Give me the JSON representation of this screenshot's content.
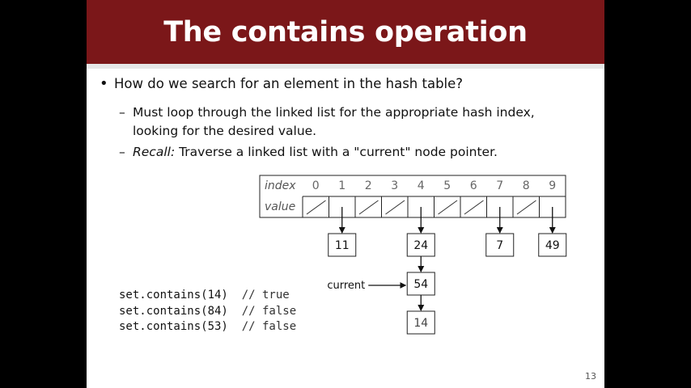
{
  "slide": {
    "title": "The contains operation",
    "bullet": "How do we search for an element in the hash table?",
    "sub1": "Must loop through the linked list for the appropriate hash index, looking for the desired value.",
    "sub2_prefix": "Recall:",
    "sub2_rest": " Traverse a linked list with a \"current\" node pointer.",
    "dash": "–",
    "bullet_glyph": "•",
    "page_number": "13"
  },
  "table": {
    "index_label": "index",
    "value_label": "value",
    "indices": [
      "0",
      "1",
      "2",
      "3",
      "4",
      "5",
      "6",
      "7",
      "8",
      "9"
    ],
    "slots": [
      {
        "index": "0",
        "nodes": []
      },
      {
        "index": "1",
        "nodes": [
          "11"
        ]
      },
      {
        "index": "2",
        "nodes": []
      },
      {
        "index": "3",
        "nodes": []
      },
      {
        "index": "4",
        "nodes": [
          "24",
          "54",
          "14"
        ]
      },
      {
        "index": "5",
        "nodes": []
      },
      {
        "index": "6",
        "nodes": []
      },
      {
        "index": "7",
        "nodes": [
          "7"
        ]
      },
      {
        "index": "8",
        "nodes": []
      },
      {
        "index": "9",
        "nodes": [
          "49"
        ]
      }
    ],
    "current_label": "current"
  },
  "code": [
    {
      "call": "set.contains(14)",
      "comment": "// true"
    },
    {
      "call": "set.contains(84)",
      "comment": "// false"
    },
    {
      "call": "set.contains(53)",
      "comment": "// false"
    }
  ],
  "colors": {
    "title_bg": "#7b1719",
    "slide_bg": "#ffffff",
    "frame_bg": "#000000"
  }
}
